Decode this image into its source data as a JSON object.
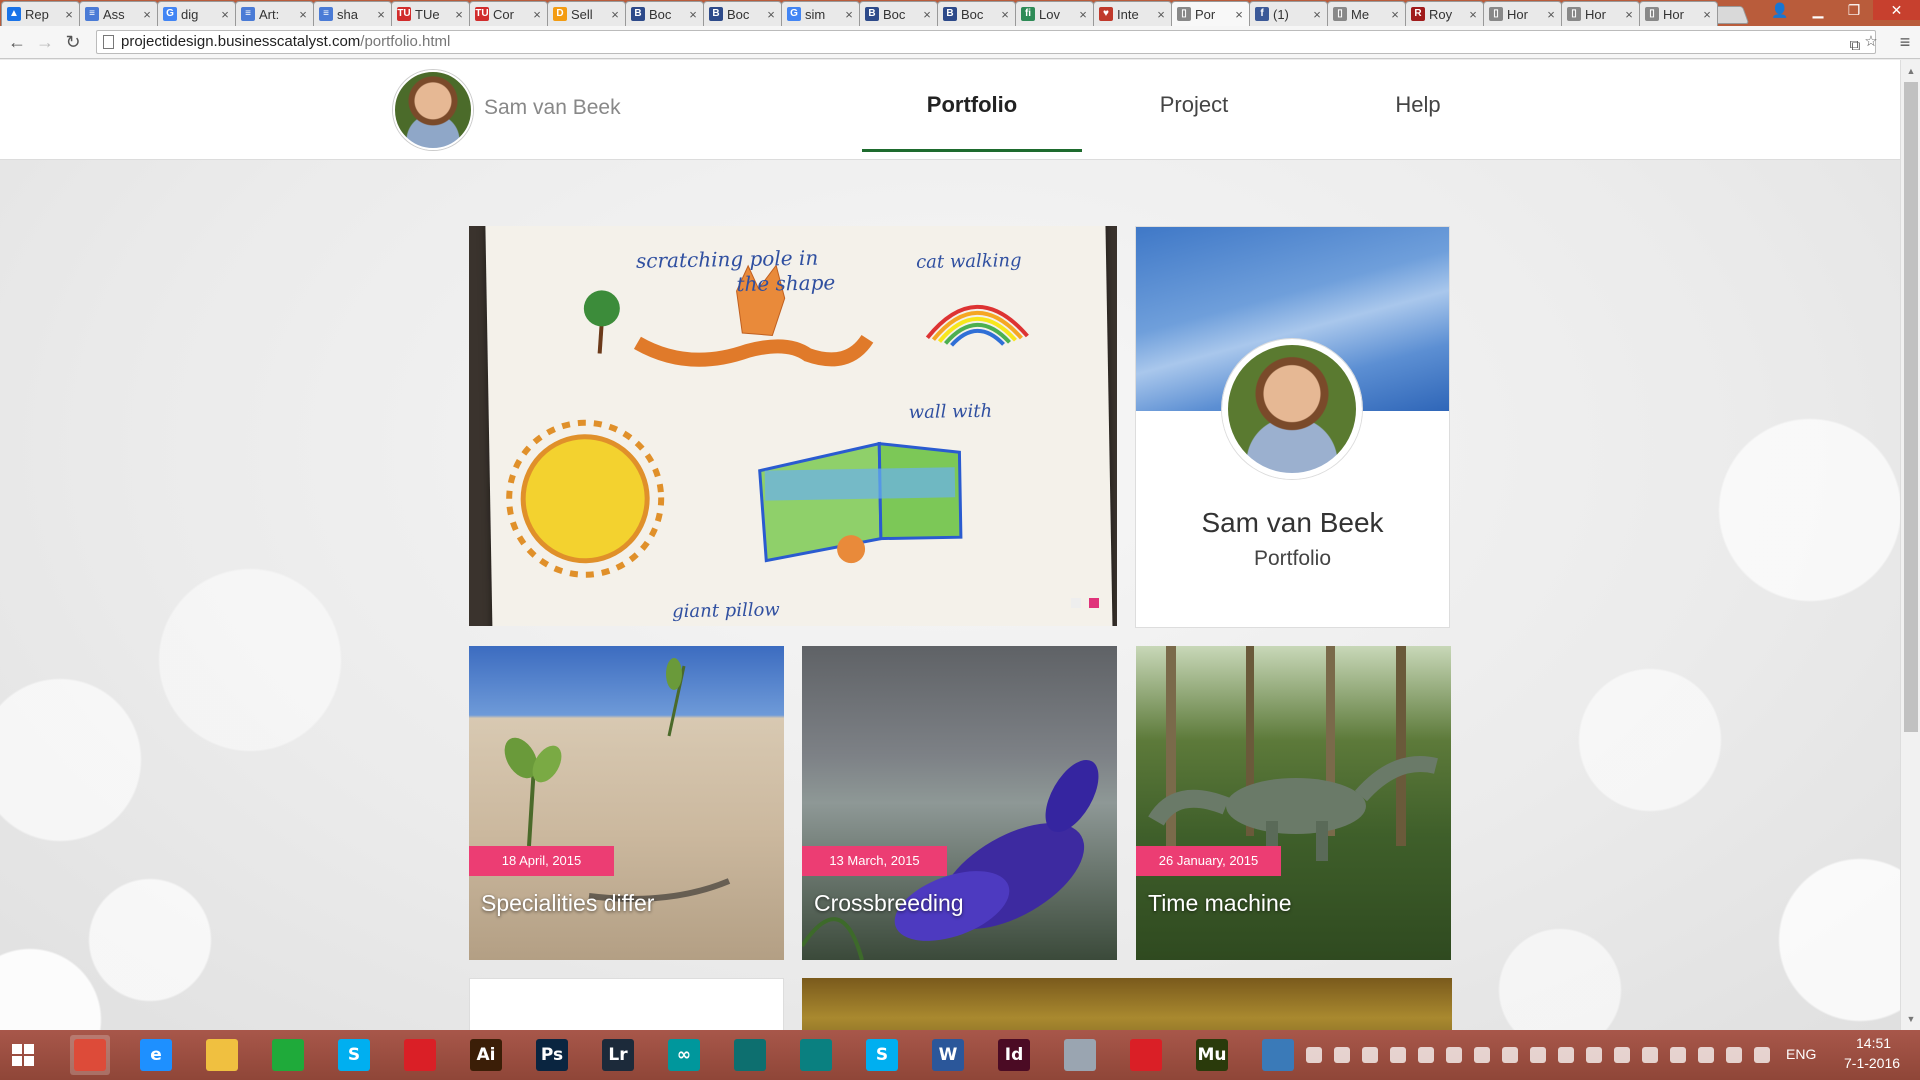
{
  "browser": {
    "tabs": [
      {
        "label": "Rep",
        "color": "#1a73e8",
        "glyph": "▲"
      },
      {
        "label": "Ass",
        "color": "#4a7bd6",
        "glyph": "≡"
      },
      {
        "label": "dig",
        "color": "#4285f4",
        "glyph": "G"
      },
      {
        "label": "Art:",
        "color": "#4a7bd6",
        "glyph": "≡"
      },
      {
        "label": "sha",
        "color": "#4a7bd6",
        "glyph": "≡"
      },
      {
        "label": "TUe",
        "color": "#d12c2c",
        "glyph": "TU"
      },
      {
        "label": "Cor",
        "color": "#d12c2c",
        "glyph": "TU"
      },
      {
        "label": "Sell",
        "color": "#f39c12",
        "glyph": "D"
      },
      {
        "label": "Boc",
        "color": "#2d4a8a",
        "glyph": "B"
      },
      {
        "label": "Boc",
        "color": "#2d4a8a",
        "glyph": "B"
      },
      {
        "label": "sim",
        "color": "#4285f4",
        "glyph": "G"
      },
      {
        "label": "Boc",
        "color": "#2d4a8a",
        "glyph": "B"
      },
      {
        "label": "Boc",
        "color": "#2d4a8a",
        "glyph": "B"
      },
      {
        "label": "Lov",
        "color": "#2e8b57",
        "glyph": "fi"
      },
      {
        "label": "Inte",
        "color": "#c0392b",
        "glyph": "♥"
      },
      {
        "label": "Por",
        "color": "#888888",
        "glyph": "▯"
      },
      {
        "label": "(1)",
        "color": "#3b5998",
        "glyph": "f"
      },
      {
        "label": "Me",
        "color": "#888888",
        "glyph": "▯"
      },
      {
        "label": "Roy",
        "color": "#a01c1c",
        "glyph": "R"
      },
      {
        "label": "Hor",
        "color": "#888888",
        "glyph": "▯"
      },
      {
        "label": "Hor",
        "color": "#888888",
        "glyph": "▯"
      },
      {
        "label": "Hor",
        "color": "#888888",
        "glyph": "▯"
      }
    ],
    "active_tab_index": 15,
    "url_host": "projectidesign.businesscatalyst.com",
    "url_path": "/portfolio.html",
    "icons": {
      "back": "←",
      "forward": "→",
      "reload": "↻",
      "translate": "⧉",
      "star": "☆",
      "menu": "≡",
      "tab_close": "×",
      "minimize": "▁",
      "maximize": "❐",
      "close": "✕",
      "user": "👤",
      "scroll_up": "▲",
      "scroll_down": "▼"
    }
  },
  "site": {
    "header_name": "Sam van Beek",
    "nav": [
      {
        "label": "Portfolio",
        "active": true
      },
      {
        "label": "Project",
        "active": false
      },
      {
        "label": "Help",
        "active": false
      }
    ],
    "accent_color": "#1e6b2e",
    "pink": "#ec3d73"
  },
  "slider": {
    "image": "children's drawing sketch",
    "slides": 2,
    "active_slide": 2
  },
  "profile": {
    "name": "Sam van Beek",
    "role": "Portfolio"
  },
  "posts": [
    {
      "date": "18 April, 2015",
      "title": "Specialities differ",
      "image": "sand-dune-plant"
    },
    {
      "date": "13 March, 2015",
      "title": "Crossbreeding",
      "image": "purple-flowers"
    },
    {
      "date": "26 January, 2015",
      "title": "Time machine",
      "image": "dinosaur-forest"
    }
  ],
  "taskbar": {
    "apps": [
      {
        "name": "chrome",
        "label": "",
        "color": "#dd4b39"
      },
      {
        "name": "internet-explorer",
        "label": "e",
        "color": "#1e90ff"
      },
      {
        "name": "file-explorer",
        "label": "",
        "color": "#f0c040"
      },
      {
        "name": "windows-store",
        "label": "",
        "color": "#1faa3a"
      },
      {
        "name": "skype",
        "label": "S",
        "color": "#00aff0"
      },
      {
        "name": "creative-cloud",
        "label": "",
        "color": "#da1f26"
      },
      {
        "name": "illustrator",
        "label": "Ai",
        "color": "#3b1e07"
      },
      {
        "name": "photoshop",
        "label": "Ps",
        "color": "#0a2540"
      },
      {
        "name": "lightroom",
        "label": "Lr",
        "color": "#1c2a3a"
      },
      {
        "name": "arduino",
        "label": "∞",
        "color": "#00979c"
      },
      {
        "name": "3ds-max",
        "label": "",
        "color": "#0d6f6f"
      },
      {
        "name": "maya",
        "label": "",
        "color": "#0a8080"
      },
      {
        "name": "skype-2",
        "label": "S",
        "color": "#00aff0"
      },
      {
        "name": "word",
        "label": "W",
        "color": "#2b579a"
      },
      {
        "name": "indesign",
        "label": "Id",
        "color": "#4b0b24"
      },
      {
        "name": "calculator",
        "label": "",
        "color": "#9aa5b1"
      },
      {
        "name": "creative-cloud-2",
        "label": "",
        "color": "#da1f26"
      },
      {
        "name": "muse",
        "label": "Mu",
        "color": "#2a3a0b"
      },
      {
        "name": "photos",
        "label": "",
        "color": "#3a7ab8"
      }
    ],
    "language": "ENG",
    "time": "14:51",
    "date": "7-1-2016"
  }
}
